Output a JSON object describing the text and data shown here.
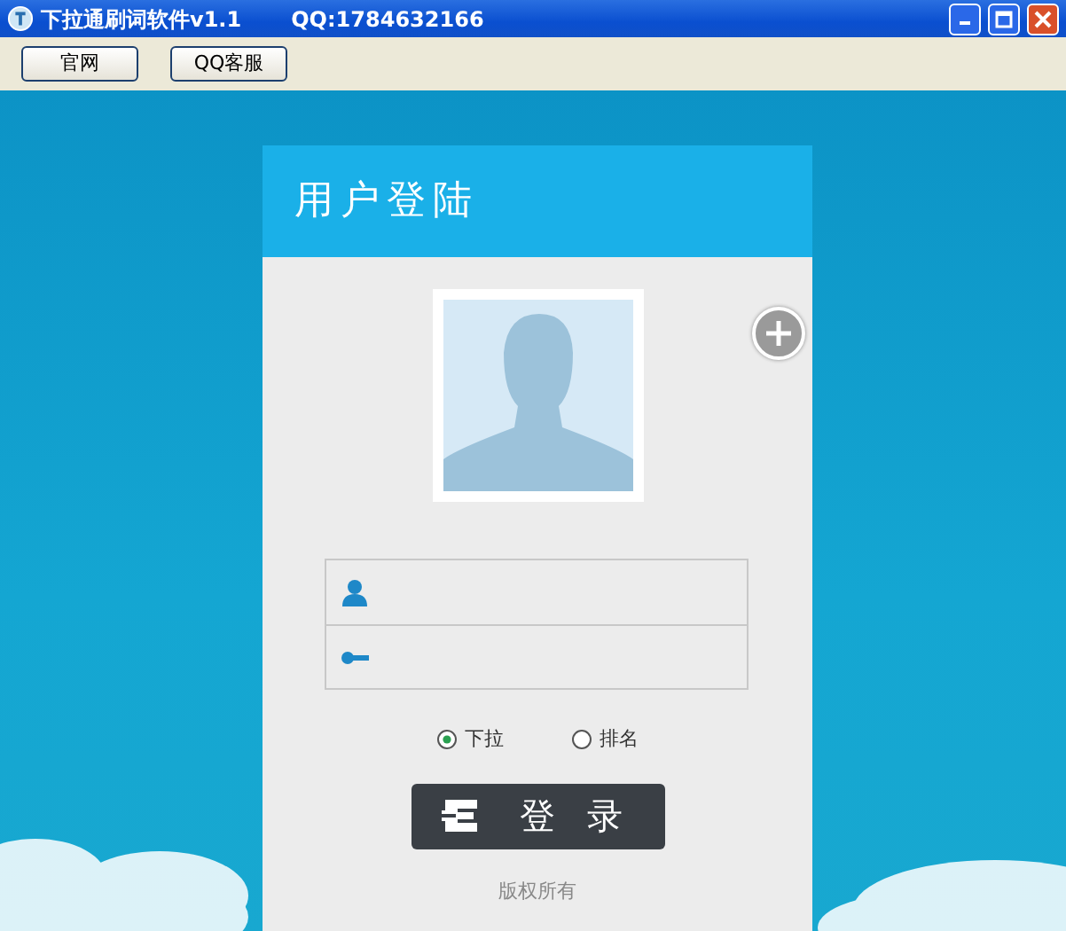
{
  "window": {
    "title": "下拉通刷词软件v1.1",
    "contact": "QQ:1784632166"
  },
  "toolbar": [
    "官网",
    "QQ客服"
  ],
  "login": {
    "heading": "用户登陆",
    "fields": [
      {
        "kind": "user"
      },
      {
        "kind": "key"
      }
    ],
    "modes": [
      {
        "label": "下拉",
        "selected": true
      },
      {
        "label": "排名",
        "selected": false
      }
    ],
    "button": "登 录",
    "footer": "版权所有"
  }
}
